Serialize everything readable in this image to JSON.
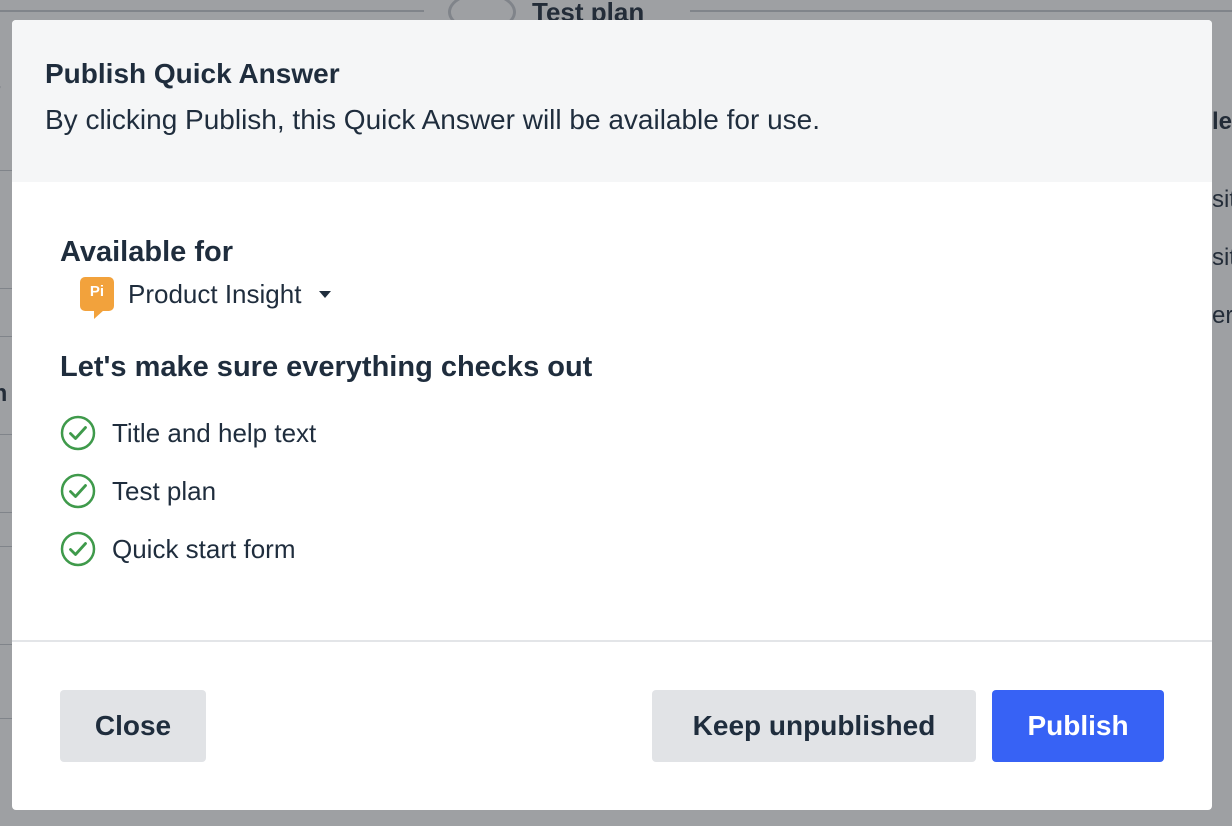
{
  "background": {
    "step_label": "Test plan",
    "right_fragments": [
      "le",
      "sit",
      "sit",
      "er"
    ],
    "left_fragments": [
      "tr",
      "m"
    ]
  },
  "modal": {
    "title": "Publish Quick Answer",
    "subtitle": "By clicking Publish, this Quick Answer will be available for use.",
    "available_for": {
      "heading": "Available for",
      "product": {
        "icon_text": "Pi",
        "name": "Product Insight",
        "icon_color": "#f2a23c"
      }
    },
    "checks": {
      "heading": "Let's make sure everything checks out",
      "items": [
        {
          "label": "Title and help text",
          "status": "passed"
        },
        {
          "label": "Test plan",
          "status": "passed"
        },
        {
          "label": "Quick start form",
          "status": "passed"
        }
      ],
      "check_color": "#3f9a4b"
    },
    "footer": {
      "close_label": "Close",
      "keep_unpublished_label": "Keep unpublished",
      "publish_label": "Publish"
    }
  },
  "colors": {
    "primary": "#3762f5",
    "text": "#1f2d3d",
    "secondary_button": "#e1e3e6",
    "header_bg": "#f5f6f7"
  }
}
